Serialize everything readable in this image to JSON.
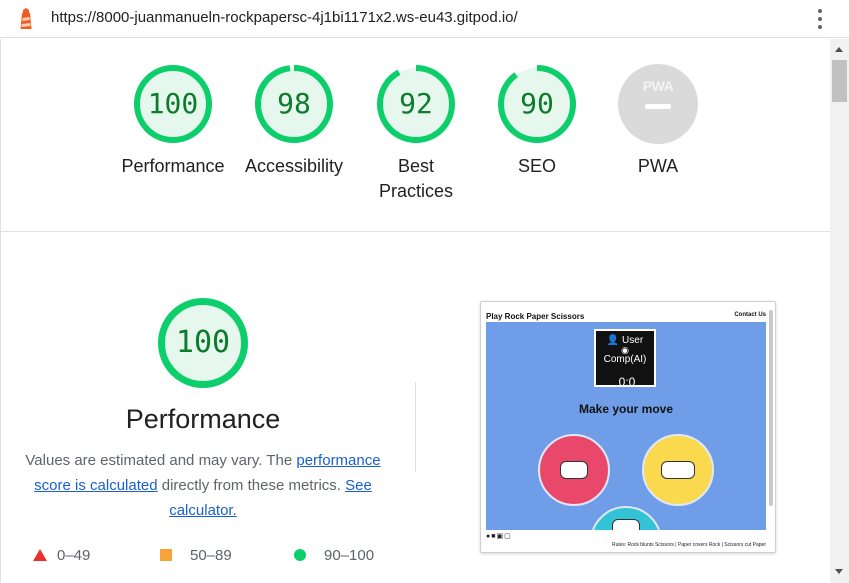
{
  "browser": {
    "url": "https://8000-juanmanueln-rockpapersc-4j1bi1171x2.ws-eu43.gitpod.io/",
    "app_icon": "lighthouse-icon",
    "menu_icon": "kebab-menu-icon"
  },
  "scores": [
    {
      "value": "100",
      "label": "Performance",
      "percent": 100
    },
    {
      "value": "98",
      "label": "Accessibility",
      "percent": 98
    },
    {
      "value": "92",
      "label": "Best Practices",
      "percent": 92
    },
    {
      "value": "90",
      "label": "SEO",
      "percent": 90
    },
    {
      "label": "PWA",
      "badge_text": "PWA"
    }
  ],
  "performance": {
    "score": "100",
    "percent": 100,
    "title": "Performance",
    "desc_before": "Values are estimated and may vary. The ",
    "desc_link1": "performance score is calculated",
    "desc_middle": " directly from these metrics. ",
    "desc_link2": "See calculator.",
    "legend": [
      {
        "range": "0–49",
        "color": "#e8312b",
        "shape": "triangle"
      },
      {
        "range": "50–89",
        "color": "#f8a23a",
        "shape": "square"
      },
      {
        "range": "90–100",
        "color": "#0cce6b",
        "shape": "circle"
      }
    ]
  },
  "thumbnail": {
    "title": "Play Rock Paper Scissors",
    "contact": "Contact Us",
    "user": "User",
    "comp": "Comp(AI)",
    "score": "0:0",
    "move_prompt": "Make your move",
    "rules": "Rules: Rock blunts Scissors | Paper covers Rock | Scissors cut Paper"
  },
  "colors": {
    "pass": "#0cce6b",
    "pass_text": "#0c7c2a",
    "pass_bg": "#e6f8ee",
    "thumb_bg": "#6f9de8",
    "rock": "#e9486b",
    "paper": "#fbd94e",
    "scissors": "#33c3d6"
  }
}
